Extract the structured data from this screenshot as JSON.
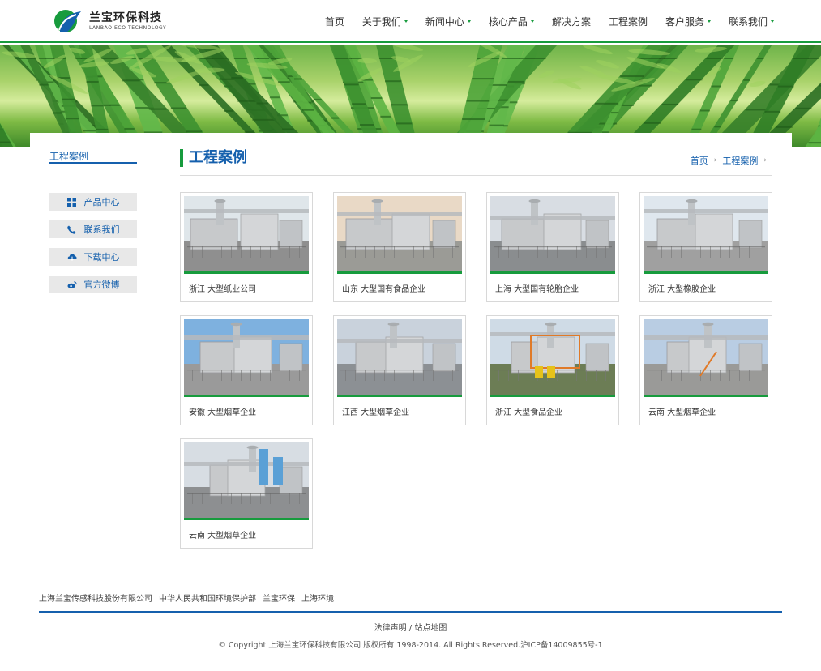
{
  "brand": {
    "name_cn": "兰宝环保科技",
    "name_en": "LANBAO ECO TECHNOLOGY",
    "green": "#179b3d",
    "blue": "#1560ad"
  },
  "nav": {
    "items": [
      {
        "label": "首页",
        "dropdown": false
      },
      {
        "label": "关于我们",
        "dropdown": true
      },
      {
        "label": "新闻中心",
        "dropdown": true
      },
      {
        "label": "核心产品",
        "dropdown": true
      },
      {
        "label": "解决方案",
        "dropdown": false
      },
      {
        "label": "工程案例",
        "dropdown": false
      },
      {
        "label": "客户服务",
        "dropdown": true
      },
      {
        "label": "联系我们",
        "dropdown": true
      }
    ]
  },
  "sidebar": {
    "title": "工程案例",
    "buttons": [
      {
        "label": "产品中心",
        "icon": "grid-icon"
      },
      {
        "label": "联系我们",
        "icon": "phone-icon"
      },
      {
        "label": "下载中心",
        "icon": "cloud-download-icon"
      },
      {
        "label": "官方微博",
        "icon": "weibo-icon"
      }
    ]
  },
  "page": {
    "title": "工程案例",
    "breadcrumb": [
      "首页",
      "工程案例"
    ]
  },
  "cases": [
    {
      "caption": "浙江 大型纸业公司",
      "sky": "#dfe6ea"
    },
    {
      "caption": "山东 大型国有食品企业",
      "sky": "#e9d9c6"
    },
    {
      "caption": "上海 大型国有轮胎企业",
      "sky": "#d8dde3"
    },
    {
      "caption": "浙江 大型橡胶企业",
      "sky": "#dfe7ee"
    },
    {
      "caption": "安徽 大型烟草企业",
      "sky": "#7eb1df"
    },
    {
      "caption": "江西 大型烟草企业",
      "sky": "#c9d2dc"
    },
    {
      "caption": "浙江 大型食品企业",
      "sky": "#cfdbe6"
    },
    {
      "caption": "云南 大型烟草企业",
      "sky": "#b9cde3"
    },
    {
      "caption": "云南 大型烟草企业",
      "sky": "#d7dde3"
    }
  ],
  "footer": {
    "links": [
      "上海兰宝传感科技股份有限公司",
      "中华人民共和国环境保护部",
      "兰宝环保",
      "上海环境"
    ],
    "legal": "法律声明 / 站点地图",
    "copyright": "© Copyright 上海兰宝环保科技有限公司 版权所有 1998-2014. All Rights Reserved.沪ICP备14009855号-1"
  }
}
